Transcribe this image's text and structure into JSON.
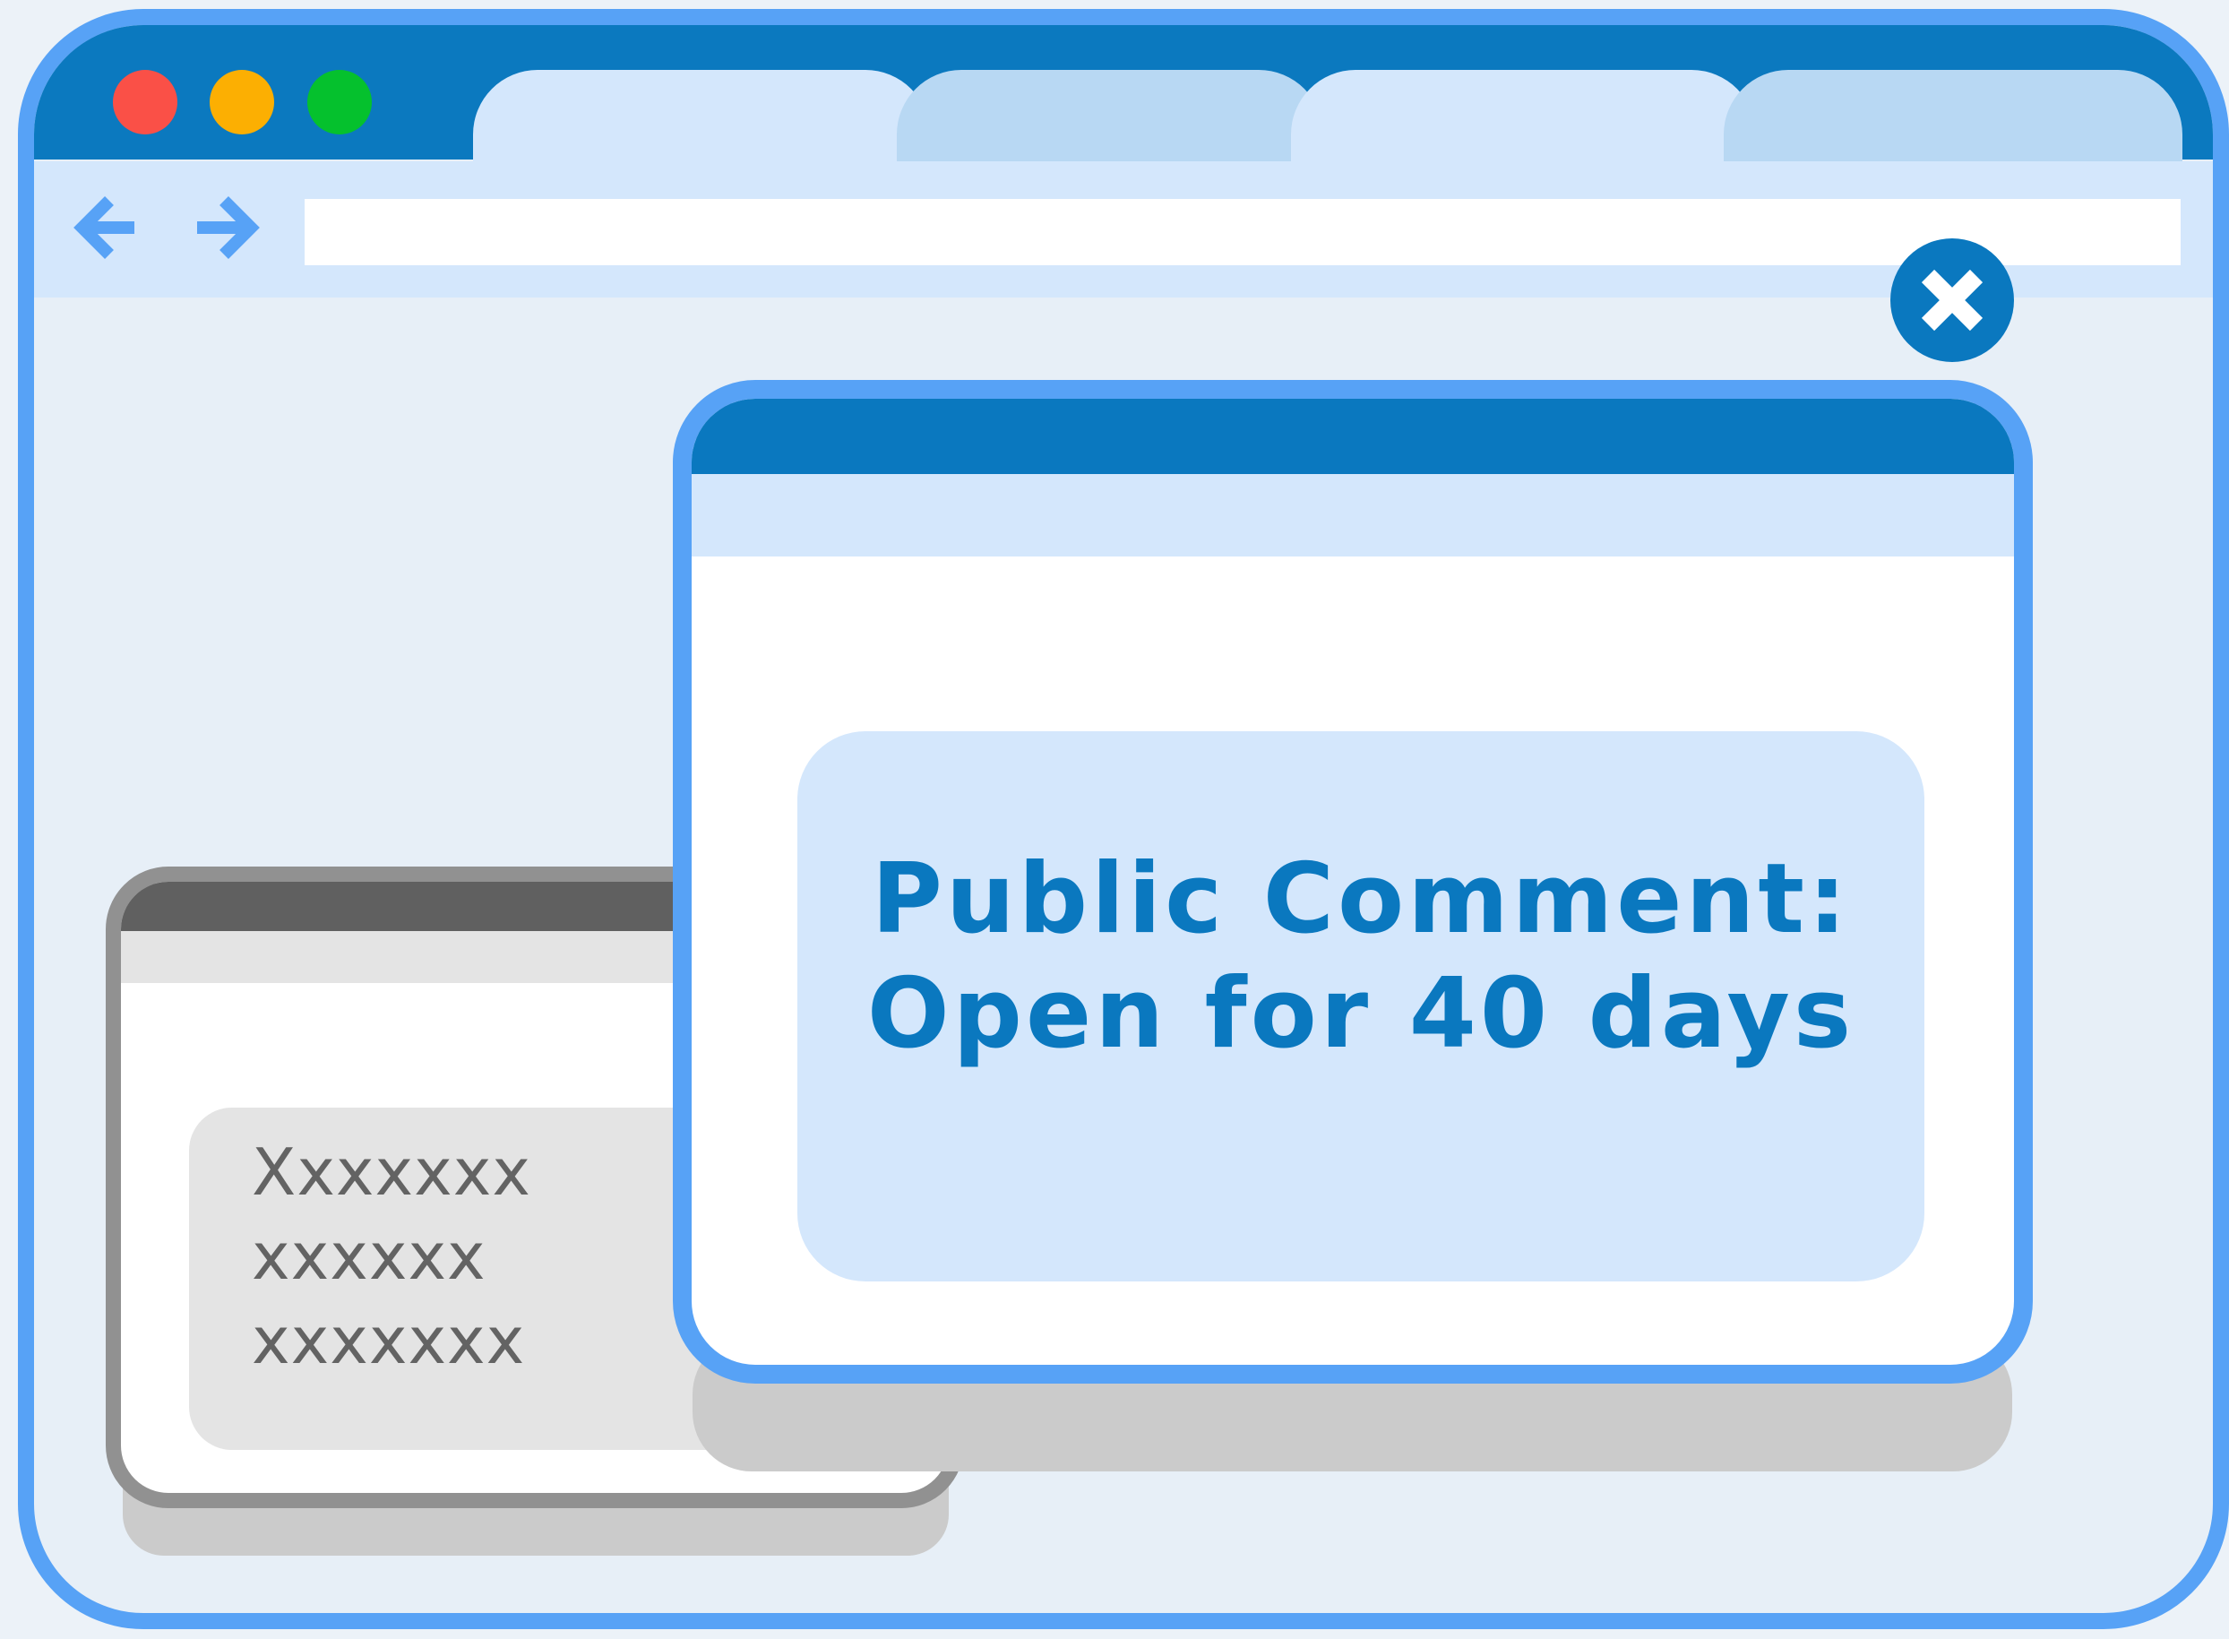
{
  "window_controls": {
    "close_color": "#fa5047",
    "minimize_color": "#fcaf02",
    "maximize_color": "#05c12d"
  },
  "browser": {
    "tabs": [
      {
        "state": "active"
      },
      {
        "state": "inactive"
      },
      {
        "state": "active"
      },
      {
        "state": "inactive"
      }
    ],
    "nav": {
      "back_icon": "arrow-left-icon",
      "forward_icon": "arrow-right-icon"
    },
    "address_bar": {
      "value": ""
    }
  },
  "close_button": {
    "icon": "close-x-icon"
  },
  "popup_back": {
    "lines": [
      "Xxxxxxx",
      "xxxxxx",
      "xxxxxxx"
    ]
  },
  "popup_front": {
    "headline_line1": "Public Comment:",
    "headline_line2": "Open for 40 days"
  },
  "colors": {
    "primary": "#0a78bf",
    "accent_border": "#57a2f6",
    "light_blue": "#d4e7fc",
    "tab_inactive": "#b8d8f3",
    "gray_text": "#636363",
    "gray_border": "#919191"
  }
}
